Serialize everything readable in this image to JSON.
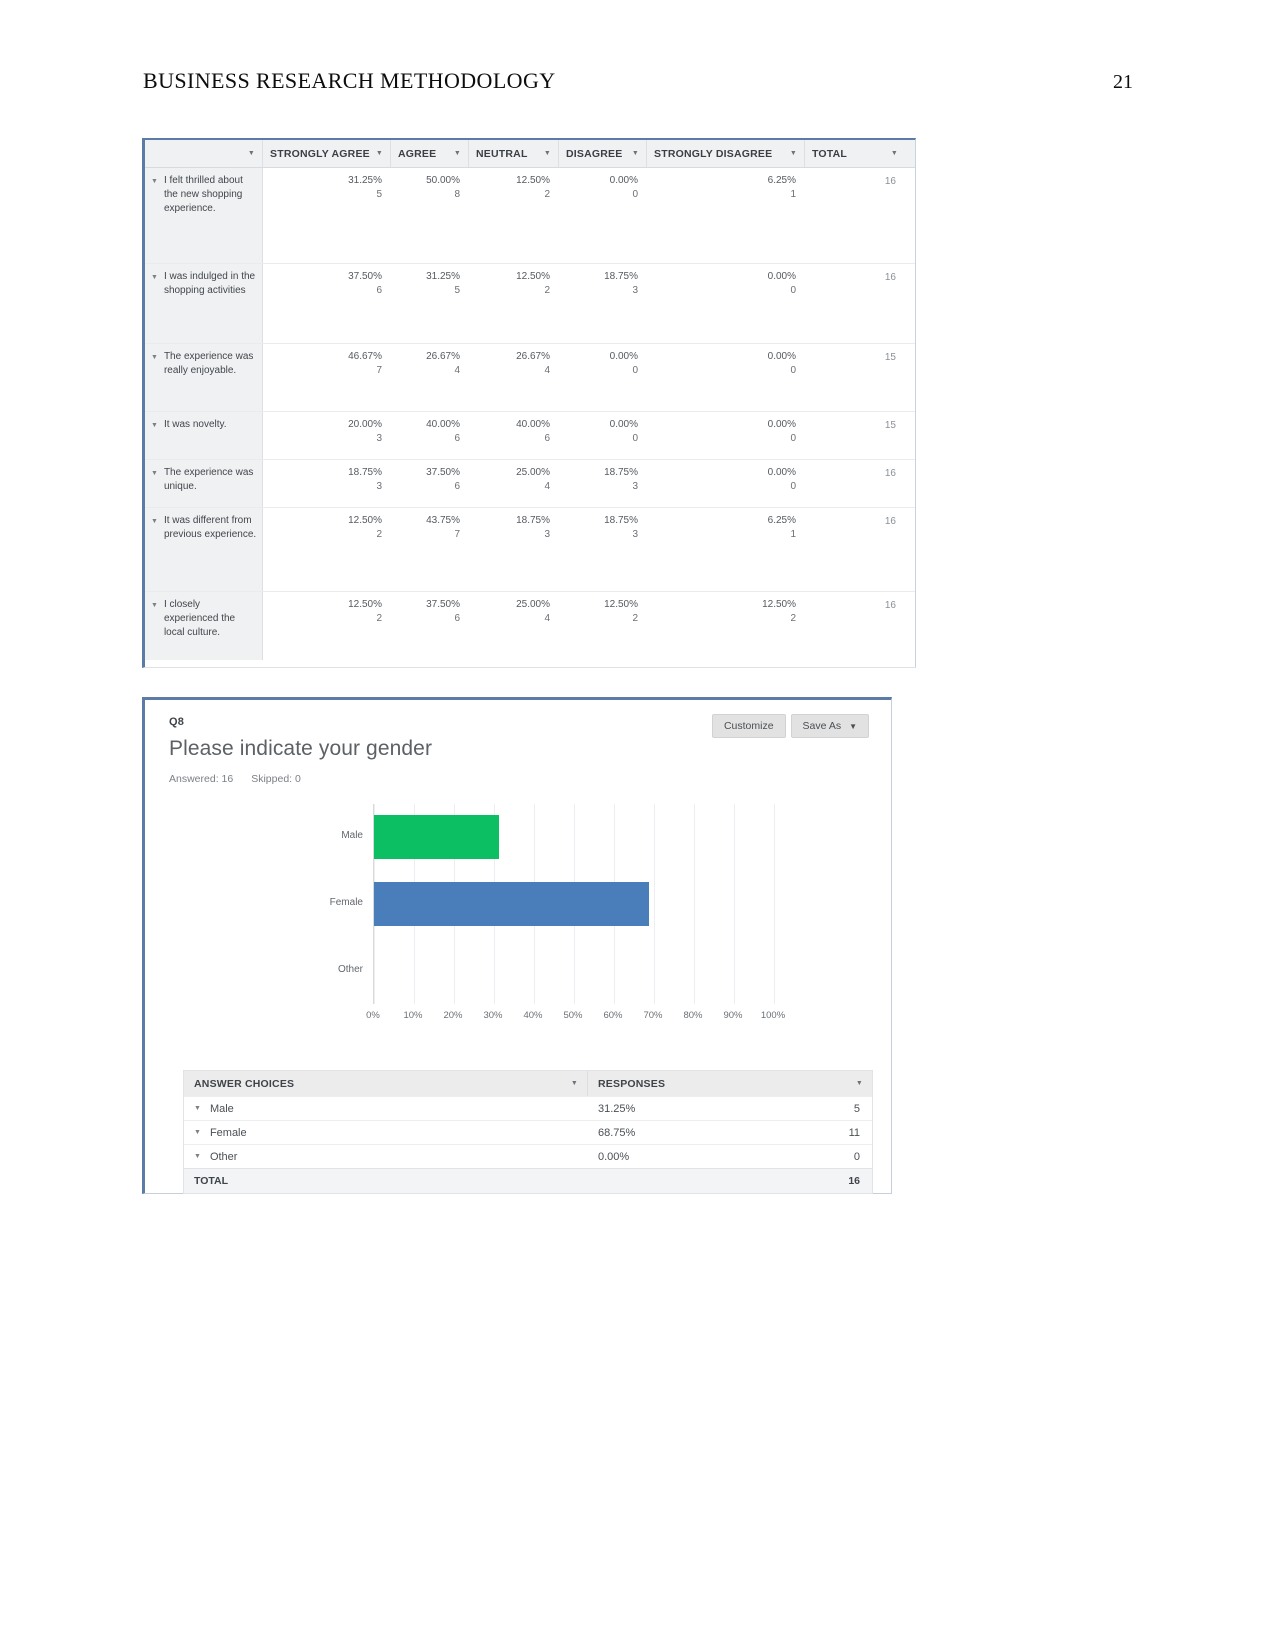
{
  "document": {
    "header_title": "BUSINESS RESEARCH METHODOLOGY",
    "page_number": "21"
  },
  "matrix_table": {
    "columns": [
      {
        "key": "question",
        "label": ""
      },
      {
        "key": "strongly_agree",
        "label": "STRONGLY AGREE"
      },
      {
        "key": "agree",
        "label": "AGREE"
      },
      {
        "key": "neutral",
        "label": "NEUTRAL"
      },
      {
        "key": "disagree",
        "label": "DISAGREE"
      },
      {
        "key": "strongly_disagree",
        "label": "STRONGLY DISAGREE"
      },
      {
        "key": "total",
        "label": "TOTAL"
      }
    ],
    "rows": [
      {
        "question": "I felt thrilled about the new shopping experience.",
        "strongly_agree_pct": "31.25%",
        "strongly_agree_n": "5",
        "agree_pct": "50.00%",
        "agree_n": "8",
        "neutral_pct": "12.50%",
        "neutral_n": "2",
        "disagree_pct": "0.00%",
        "disagree_n": "0",
        "strongly_disagree_pct": "6.25%",
        "strongly_disagree_n": "1",
        "total": "16"
      },
      {
        "question": "I was indulged in the shopping activities",
        "strongly_agree_pct": "37.50%",
        "strongly_agree_n": "6",
        "agree_pct": "31.25%",
        "agree_n": "5",
        "neutral_pct": "12.50%",
        "neutral_n": "2",
        "disagree_pct": "18.75%",
        "disagree_n": "3",
        "strongly_disagree_pct": "0.00%",
        "strongly_disagree_n": "0",
        "total": "16"
      },
      {
        "question": "The experience was really enjoyable.",
        "strongly_agree_pct": "46.67%",
        "strongly_agree_n": "7",
        "agree_pct": "26.67%",
        "agree_n": "4",
        "neutral_pct": "26.67%",
        "neutral_n": "4",
        "disagree_pct": "0.00%",
        "disagree_n": "0",
        "strongly_disagree_pct": "0.00%",
        "strongly_disagree_n": "0",
        "total": "15"
      },
      {
        "question": "It was novelty.",
        "strongly_agree_pct": "20.00%",
        "strongly_agree_n": "3",
        "agree_pct": "40.00%",
        "agree_n": "6",
        "neutral_pct": "40.00%",
        "neutral_n": "6",
        "disagree_pct": "0.00%",
        "disagree_n": "0",
        "strongly_disagree_pct": "0.00%",
        "strongly_disagree_n": "0",
        "total": "15"
      },
      {
        "question": "The experience was unique.",
        "strongly_agree_pct": "18.75%",
        "strongly_agree_n": "3",
        "agree_pct": "37.50%",
        "agree_n": "6",
        "neutral_pct": "25.00%",
        "neutral_n": "4",
        "disagree_pct": "18.75%",
        "disagree_n": "3",
        "strongly_disagree_pct": "0.00%",
        "strongly_disagree_n": "0",
        "total": "16"
      },
      {
        "question": "It was different from previous experience.",
        "strongly_agree_pct": "12.50%",
        "strongly_agree_n": "2",
        "agree_pct": "43.75%",
        "agree_n": "7",
        "neutral_pct": "18.75%",
        "neutral_n": "3",
        "disagree_pct": "18.75%",
        "disagree_n": "3",
        "strongly_disagree_pct": "6.25%",
        "strongly_disagree_n": "1",
        "total": "16"
      },
      {
        "question": "I closely experienced the local culture.",
        "strongly_agree_pct": "12.50%",
        "strongly_agree_n": "2",
        "agree_pct": "37.50%",
        "agree_n": "6",
        "neutral_pct": "25.00%",
        "neutral_n": "4",
        "disagree_pct": "12.50%",
        "disagree_n": "2",
        "strongly_disagree_pct": "12.50%",
        "strongly_disagree_n": "2",
        "total": "16"
      }
    ]
  },
  "q8": {
    "question_number": "Q8",
    "question_title": "Please indicate your gender",
    "answered_label": "Answered: 16",
    "skipped_label": "Skipped: 0",
    "customize_button": "Customize",
    "save_as_button": "Save As",
    "answer_table": {
      "col_answer_choices": "ANSWER CHOICES",
      "col_responses": "RESPONSES",
      "rows": [
        {
          "choice": "Male",
          "pct": "31.25%",
          "count": "5"
        },
        {
          "choice": "Female",
          "pct": "68.75%",
          "count": "11"
        },
        {
          "choice": "Other",
          "pct": "0.00%",
          "count": "0"
        }
      ],
      "total_label": "TOTAL",
      "total_count": "16"
    }
  },
  "chart_data": {
    "type": "bar",
    "orientation": "horizontal",
    "title": "Please indicate your gender",
    "categories": [
      "Male",
      "Female",
      "Other"
    ],
    "values": [
      31.25,
      68.75,
      0.0
    ],
    "counts": [
      5,
      11,
      0
    ],
    "colors": [
      "#0bbf62",
      "#4a7ebb",
      "#4a7ebb"
    ],
    "xlabel": "",
    "ylabel": "",
    "xlim": [
      0,
      100
    ],
    "xticks": [
      "0%",
      "10%",
      "20%",
      "30%",
      "40%",
      "50%",
      "60%",
      "70%",
      "80%",
      "90%",
      "100%"
    ],
    "grid": true,
    "legend": false
  }
}
